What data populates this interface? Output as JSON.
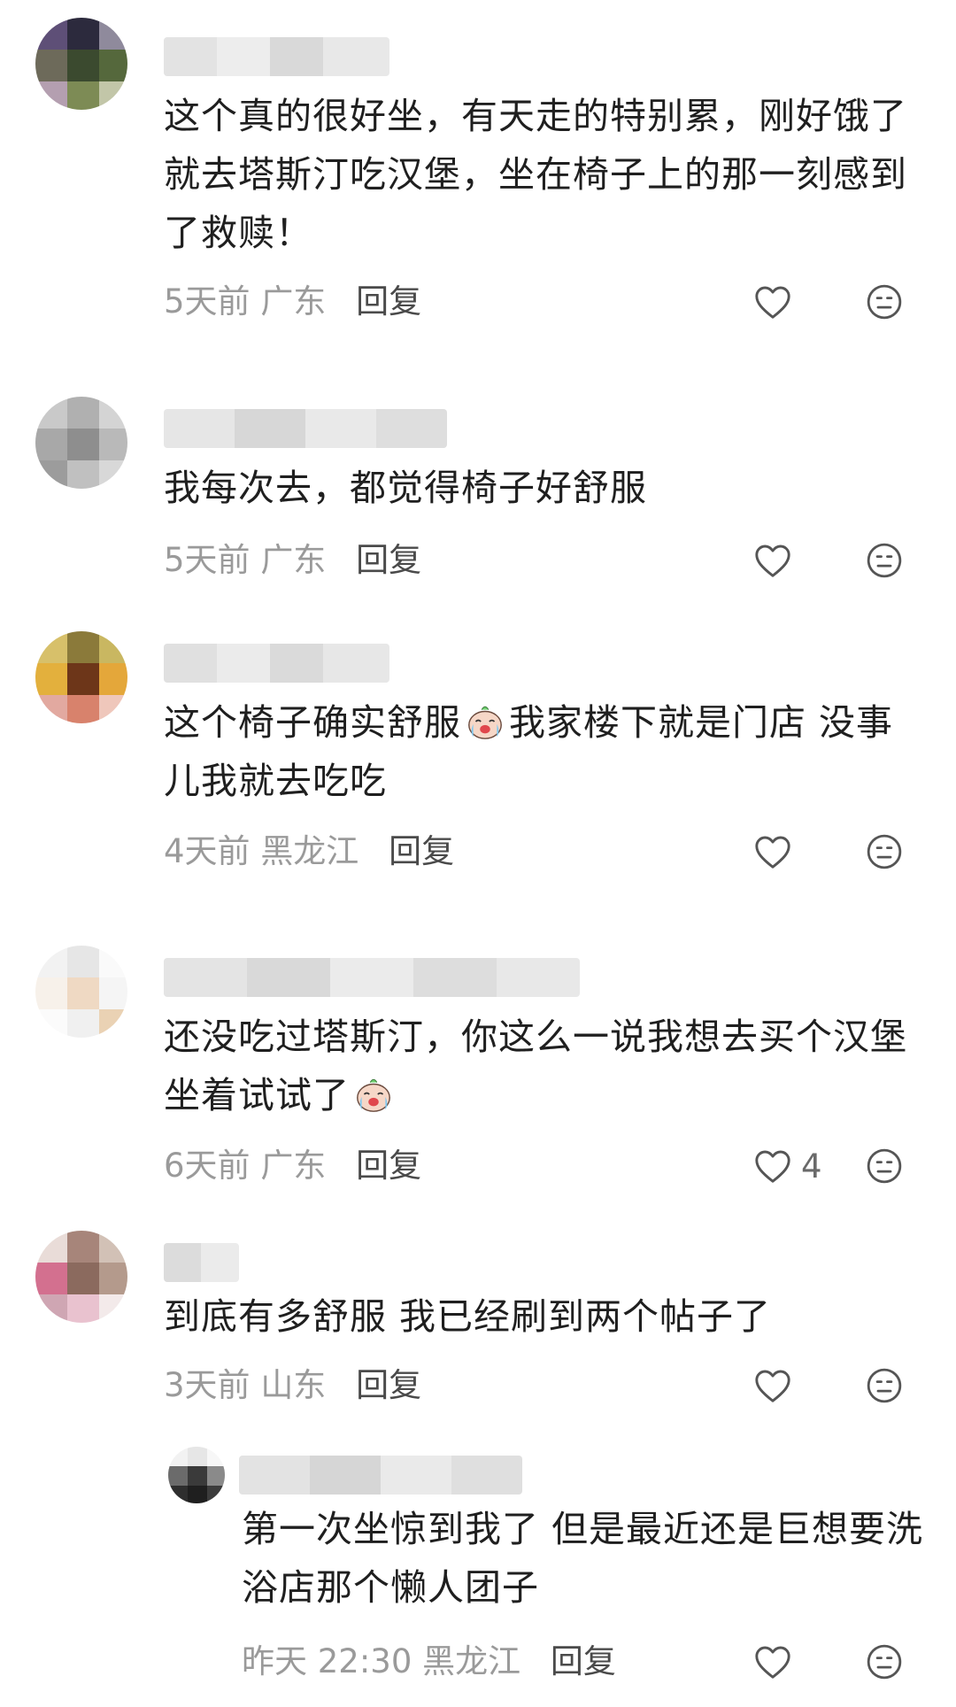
{
  "comments": [
    {
      "text": "这个真的很好坐，有天走的特别累，刚好饿了就去塔斯汀吃汉堡，坐在椅子上的那一刻感到了救赎！",
      "lines": [
        "这个真的很好坐，有天走的特别累，刚好饿了",
        "就去塔斯汀吃汉堡，坐在椅子上的那一刻感到",
        "了救赎！"
      ],
      "time": "5天前",
      "location": "广东",
      "reply": "回复",
      "likes": ""
    },
    {
      "text": "我每次去，都觉得椅子好舒服",
      "lines": [
        "我每次去，都觉得椅子好舒服"
      ],
      "time": "5天前",
      "location": "广东",
      "reply": "回复",
      "likes": ""
    },
    {
      "text": "这个椅子确实舒服[emoji] 我家楼下就是门店 没事儿我就去吃吃",
      "line1_a": "这个椅子确实舒服",
      "line1_b": "我家楼下就是门店 没事",
      "line2": "儿我就去吃吃",
      "time": "4天前",
      "location": "黑龙江",
      "reply": "回复",
      "likes": ""
    },
    {
      "text": "还没吃过塔斯汀，你这么一说我想去买个汉堡坐着试试了[emoji]",
      "line1": "还没吃过塔斯汀，你这么一说我想去买个汉堡",
      "line2": "坐着试试了",
      "time": "6天前",
      "location": "广东",
      "reply": "回复",
      "likes": "4"
    },
    {
      "text": "到底有多舒服 我已经刷到两个帖子了",
      "lines": [
        "到底有多舒服 我已经刷到两个帖子了"
      ],
      "time": "3天前",
      "location": "山东",
      "reply": "回复",
      "likes": ""
    }
  ],
  "reply": {
    "lines": [
      "第一次坐惊到我了 但是最近还是巨想要洗",
      "浴店那个懒人团子"
    ],
    "time": "昨天 22:30",
    "location": "黑龙江",
    "reply": "回复",
    "likes": ""
  },
  "icons": {
    "like": "heart-outline-icon",
    "dislike": "neutral-face-icon",
    "emoji": "crying-laughing-sticker"
  },
  "colors": {
    "text": "#1f1f1f",
    "meta": "#9a9a9a",
    "reply": "#4a4a4a",
    "icon": "#555555"
  }
}
